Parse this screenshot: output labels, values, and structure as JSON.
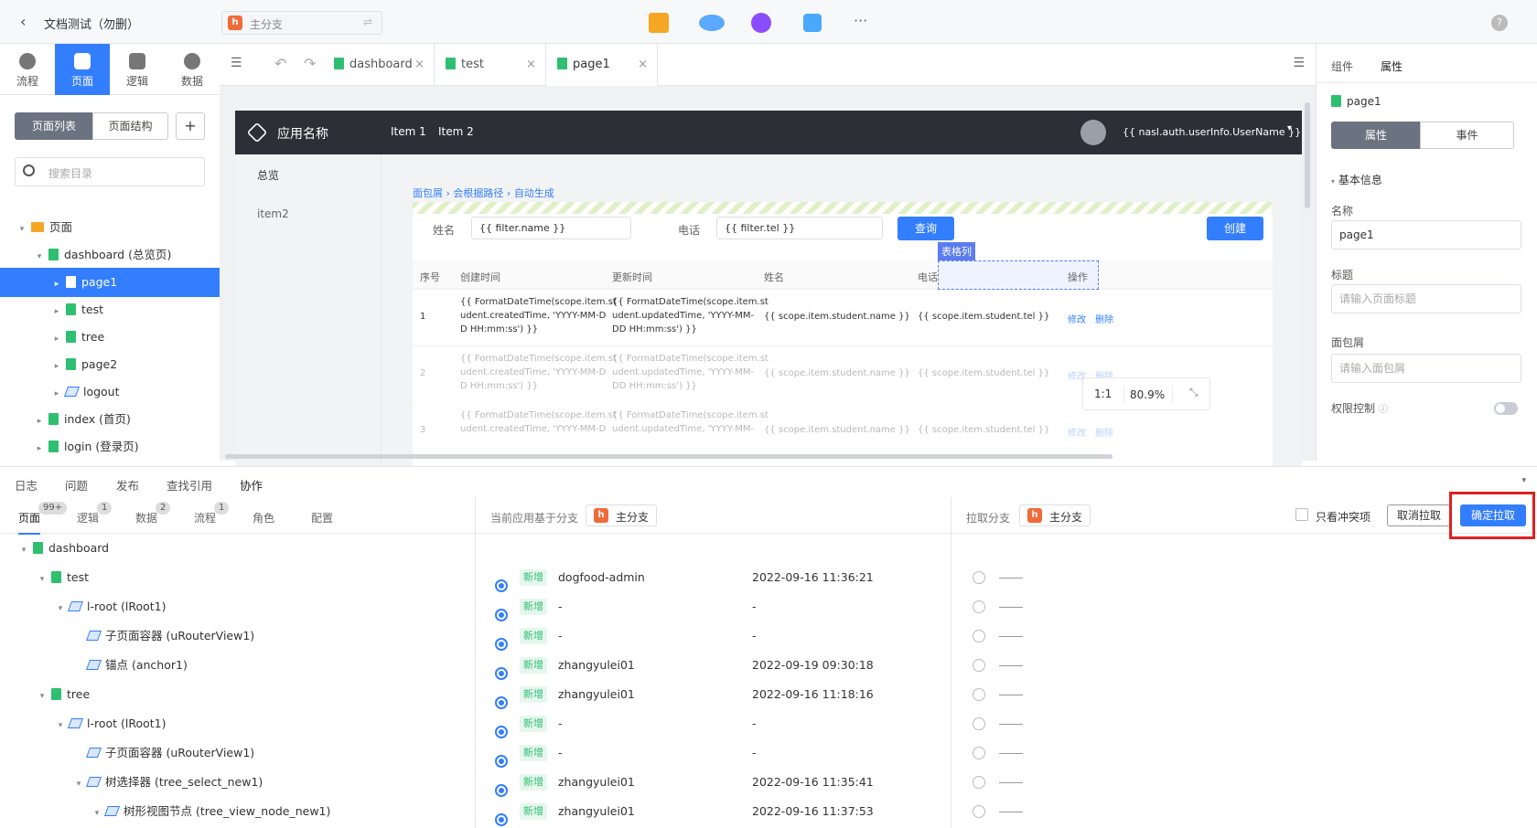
{
  "header": {
    "back": "‹",
    "title": "文档测试（勿删）",
    "branch": "主分支",
    "branch_icon": "h",
    "switch_icon": "⇌",
    "more": "···",
    "help": "?"
  },
  "leftnav": {
    "tabs": [
      "流程",
      "页面",
      "逻辑",
      "数据"
    ],
    "seg": [
      "页面列表",
      "页面结构"
    ],
    "add": "+",
    "search_placeholder": "搜索目录"
  },
  "tree": [
    {
      "label": "页面",
      "level": 0,
      "type": "folder",
      "arrow": "▾"
    },
    {
      "label": "dashboard (总览页)",
      "level": 1,
      "type": "file",
      "arrow": "▾"
    },
    {
      "label": "page1",
      "level": 2,
      "type": "file",
      "arrow": "▸",
      "selected": true
    },
    {
      "label": "test",
      "level": 2,
      "type": "file",
      "arrow": "▸"
    },
    {
      "label": "tree",
      "level": 2,
      "type": "file",
      "arrow": "▸"
    },
    {
      "label": "page2",
      "level": 2,
      "type": "file",
      "arrow": "▸"
    },
    {
      "label": "logout",
      "level": 2,
      "type": "comp",
      "arrow": "▸"
    },
    {
      "label": "index (首页)",
      "level": 1,
      "type": "file",
      "arrow": "▸"
    },
    {
      "label": "login (登录页)",
      "level": 1,
      "type": "file",
      "arrow": "▸"
    }
  ],
  "doctabs": [
    {
      "label": "dashboard"
    },
    {
      "label": "test"
    },
    {
      "label": "page1",
      "active": true
    }
  ],
  "canvas": {
    "app_name": "应用名称",
    "nav": [
      "Item 1",
      "Item 2"
    ],
    "user": "{{ nasl.auth.userInfo.UserName }}",
    "side": [
      "总览",
      "item2"
    ],
    "breadcrumb": [
      "面包屑",
      "会根据路径",
      "自动生成"
    ],
    "filter": {
      "name_label": "姓名",
      "name_value": "{{ filter.name }}",
      "tel_label": "电话",
      "tel_value": "{{ filter.tel }}",
      "query": "查询",
      "create": "创建"
    },
    "col_tag": "表格列",
    "columns": [
      "序号",
      "创建时间",
      "更新时间",
      "姓名",
      "电话",
      "操作"
    ],
    "rows": [
      {
        "idx": "1",
        "created": [
          "{{ FormatDateTime(scope.item.st",
          "udent.createdTime, 'YYYY-MM-D",
          "D HH:mm:ss') }}"
        ],
        "updated": [
          "{{ FormatDateTime(scope.item.st",
          "udent.updatedTime, 'YYYY-MM-",
          "DD HH:mm:ss') }}"
        ],
        "name": "{{ scope.item.student.name }}",
        "tel": "{{ scope.item.student.tel }}",
        "edit": "修改",
        "del": "删除"
      },
      {
        "idx": "2",
        "created": [
          "{{ FormatDateTime(scope.item.st",
          "udent.createdTime, 'YYYY-MM-D",
          "D HH:mm:ss') }}"
        ],
        "updated": [
          "{{ FormatDateTime(scope.item.st",
          "udent.updatedTime, 'YYYY-MM-",
          "DD HH:mm:ss') }}"
        ],
        "name": "{{ scope.item.student.name }}",
        "tel": "{{ scope.item.student.tel }}",
        "edit": "修改",
        "del": "删除"
      },
      {
        "idx": "3",
        "created": [
          "{{ FormatDateTime(scope.item.st",
          "udent.createdTime, 'YYYY-MM-D"
        ],
        "updated": [
          "{{ FormatDateTime(scope.item.st",
          "udent.updatedTime, 'YYYY-MM-"
        ],
        "name": "{{ scope.item.student.name }}",
        "tel": "{{ scope.item.student.tel }}",
        "edit": "修改",
        "del": "删除"
      }
    ],
    "zoom": {
      "ratio": "1:1",
      "value": "80.9%"
    }
  },
  "rightpanel": {
    "tabs": [
      "组件",
      "属性"
    ],
    "page": "page1",
    "seg": [
      "属性",
      "事件"
    ],
    "section": "基本信息",
    "name_label": "名称",
    "name_value": "page1",
    "title_label": "标题",
    "title_placeholder": "请输入页面标题",
    "bc_label": "面包屑",
    "bc_placeholder": "请输入面包屑",
    "perm_label": "权限控制"
  },
  "bottom": {
    "tabs": [
      "日志",
      "问题",
      "发布",
      "查找引用",
      "协作"
    ],
    "subtabs": [
      {
        "label": "页面",
        "badge": "99+"
      },
      {
        "label": "逻辑",
        "badge": "1"
      },
      {
        "label": "数据",
        "badge": "2"
      },
      {
        "label": "流程",
        "badge": "1"
      },
      {
        "label": "角色",
        "badge": ""
      },
      {
        "label": "配置",
        "badge": ""
      }
    ],
    "base_label": "当前应用基于分支",
    "base_branch": "主分支",
    "pull_label": "拉取分支",
    "pull_branch": "主分支",
    "only_conflict": "只看冲突项",
    "cancel": "取消拉取",
    "confirm": "确定拉取",
    "rows": [
      {
        "label": "dashboard",
        "level": 0,
        "type": "file",
        "arrow": "▾",
        "status": "",
        "user": "",
        "time": ""
      },
      {
        "label": "test",
        "level": 1,
        "type": "file",
        "arrow": "▾",
        "status": "新增",
        "user": "dogfood-admin",
        "time": "2022-09-16 11:36:21"
      },
      {
        "label": "l-root (lRoot1)",
        "level": 2,
        "type": "comp",
        "arrow": "▾",
        "status": "新增",
        "user": "-",
        "time": "-"
      },
      {
        "label": "子页面容器 (uRouterView1)",
        "level": 3,
        "type": "comp",
        "arrow": "",
        "status": "新增",
        "user": "-",
        "time": "-"
      },
      {
        "label": "锚点 (anchor1)",
        "level": 3,
        "type": "comp",
        "arrow": "",
        "status": "新增",
        "user": "zhangyulei01",
        "time": "2022-09-19 09:30:18"
      },
      {
        "label": "tree",
        "level": 1,
        "type": "file",
        "arrow": "▾",
        "status": "新增",
        "user": "zhangyulei01",
        "time": "2022-09-16 11:18:16"
      },
      {
        "label": "l-root (lRoot1)",
        "level": 2,
        "type": "comp",
        "arrow": "▾",
        "status": "新增",
        "user": "-",
        "time": "-"
      },
      {
        "label": "子页面容器 (uRouterView1)",
        "level": 3,
        "type": "comp",
        "arrow": "",
        "status": "新增",
        "user": "-",
        "time": "-"
      },
      {
        "label": "树选择器 (tree_select_new1)",
        "level": 3,
        "type": "comp",
        "arrow": "▾",
        "status": "新增",
        "user": "zhangyulei01",
        "time": "2022-09-16 11:35:41"
      },
      {
        "label": "树形视图节点 (tree_view_node_new1)",
        "level": 4,
        "type": "comp",
        "arrow": "▾",
        "status": "新增",
        "user": "zhangyulei01",
        "time": "2022-09-16 11:37:53"
      }
    ]
  },
  "colors": {
    "accent": "#337eff",
    "highlight": "#e02020",
    "dark_header": "#2c2f36"
  }
}
